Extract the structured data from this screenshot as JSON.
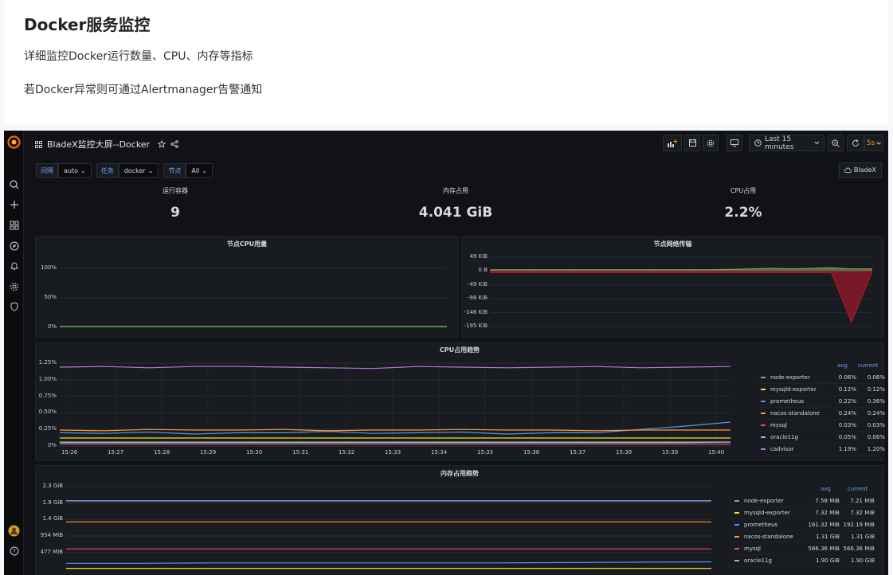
{
  "doc": {
    "title": "Docker服务监控",
    "line1": "详细监控Docker运行数量、CPU、内存等指标",
    "line2": "若Docker异常则可通过Alertmanager告警通知"
  },
  "topbar": {
    "dashboard_title": "BladeX监控大屏--Docker",
    "time_range": "Last 15 minutes",
    "refresh": "5s"
  },
  "variables": [
    {
      "label": "间隔",
      "value": "auto"
    },
    {
      "label": "任务",
      "value": "docker"
    },
    {
      "label": "节点",
      "value": "All"
    }
  ],
  "bladex_link": "BladeX",
  "stats": [
    {
      "title": "运行容器",
      "value": "9"
    },
    {
      "title": "内存占用",
      "value": "4.041 GiB"
    },
    {
      "title": "CPU占用",
      "value": "2.2%"
    }
  ],
  "colors": {
    "green": "#73bf69",
    "yellow": "#fade2a",
    "cyan": "#5794f2",
    "orange": "#ff9830",
    "red": "#f2495c",
    "blue": "#8ab8ff",
    "purple": "#b877d9",
    "lightblue": "#c0d8ff"
  },
  "chart_data": [
    {
      "type": "line",
      "title": "节点CPU用量",
      "y_ticks": [
        "100%",
        "50%",
        "0%"
      ],
      "ylim": [
        0,
        100
      ],
      "series": [
        {
          "values": [
            1.5,
            1.5,
            1.5,
            1.5,
            1.5,
            1.5,
            1.5,
            1.5,
            1.5,
            1.5,
            1.5,
            1.5,
            1.5,
            1.5,
            1.5,
            1.5
          ]
        }
      ]
    },
    {
      "type": "area",
      "title": "节点网络传输",
      "y_ticks": [
        "49 KiB",
        "0 B",
        "-49 KiB",
        "-98 KiB",
        "-146 KiB",
        "-195 KiB"
      ],
      "ylim": [
        -195,
        49
      ],
      "series": [
        {
          "values": [
            5,
            5,
            5,
            5,
            5,
            5,
            5,
            5,
            5,
            5,
            5,
            5,
            6,
            8,
            10,
            8,
            10,
            12,
            8,
            8
          ]
        },
        {
          "values": [
            -5,
            -6,
            -5,
            -6,
            -5,
            -6,
            -5,
            -6,
            -5,
            -6,
            -5,
            -6,
            -5,
            -6,
            -5,
            -6,
            -5,
            -6,
            -180,
            -8
          ]
        }
      ]
    },
    {
      "type": "line",
      "title": "CPU占用趋势",
      "y_ticks": [
        "1.25%",
        "1.00%",
        "0.75%",
        "0.50%",
        "0.25%",
        "0%"
      ],
      "x_ticks": [
        "15:26",
        "15:27",
        "15:28",
        "15:29",
        "15:30",
        "15:31",
        "15:32",
        "15:33",
        "15:34",
        "15:35",
        "15:36",
        "15:37",
        "15:38",
        "15:39",
        "15:40"
      ],
      "ylim": [
        0,
        1.25
      ],
      "legend_headers": {
        "avg": "avg",
        "current": "current"
      },
      "series": [
        {
          "name": "node-exporter",
          "avg": "0.06%",
          "current": "0.06%",
          "color": "#73bf69",
          "values": [
            0.06,
            0.06,
            0.06,
            0.06,
            0.06,
            0.06,
            0.06,
            0.06,
            0.06,
            0.06,
            0.06,
            0.06,
            0.06,
            0.06,
            0.06,
            0.06
          ]
        },
        {
          "name": "mysqld-exporter",
          "avg": "0.12%",
          "current": "0.12%",
          "color": "#fade2a",
          "values": [
            0.12,
            0.12,
            0.12,
            0.12,
            0.12,
            0.12,
            0.12,
            0.12,
            0.12,
            0.12,
            0.12,
            0.12,
            0.12,
            0.12,
            0.12,
            0.12
          ]
        },
        {
          "name": "prometheus",
          "avg": "0.22%",
          "current": "0.36%",
          "color": "#5794f2",
          "values": [
            0.2,
            0.19,
            0.21,
            0.18,
            0.2,
            0.2,
            0.22,
            0.19,
            0.2,
            0.21,
            0.18,
            0.2,
            0.2,
            0.25,
            0.3,
            0.36
          ]
        },
        {
          "name": "nacos-standalone",
          "avg": "0.24%",
          "current": "0.24%",
          "color": "#ff9830",
          "values": [
            0.24,
            0.23,
            0.25,
            0.24,
            0.24,
            0.25,
            0.23,
            0.24,
            0.24,
            0.25,
            0.24,
            0.24,
            0.23,
            0.24,
            0.24,
            0.24
          ]
        },
        {
          "name": "mysql",
          "avg": "0.03%",
          "current": "0.03%",
          "color": "#f2495c",
          "values": [
            0.03,
            0.03,
            0.03,
            0.03,
            0.03,
            0.03,
            0.03,
            0.03,
            0.03,
            0.03,
            0.03,
            0.03,
            0.03,
            0.03,
            0.03,
            0.03
          ]
        },
        {
          "name": "oracle11g",
          "avg": "0.05%",
          "current": "0.06%",
          "color": "#8ab8ff",
          "values": [
            0.05,
            0.05,
            0.05,
            0.05,
            0.05,
            0.05,
            0.05,
            0.05,
            0.05,
            0.05,
            0.05,
            0.05,
            0.05,
            0.05,
            0.05,
            0.06
          ]
        },
        {
          "name": "cadvisor",
          "avg": "1.19%",
          "current": "1.20%",
          "color": "#b877d9",
          "values": [
            1.19,
            1.2,
            1.18,
            1.2,
            1.2,
            1.19,
            1.18,
            1.17,
            1.2,
            1.19,
            1.18,
            1.19,
            1.2,
            1.18,
            1.19,
            1.2
          ]
        }
      ]
    },
    {
      "type": "line",
      "title": "内存占用趋势",
      "y_ticks": [
        "2.3 GiB",
        "1.9 GiB",
        "1.4 GiB",
        "954 MiB",
        "477 MiB"
      ],
      "ylim": [
        0,
        2.3
      ],
      "legend_headers": {
        "avg": "avg",
        "current": "current"
      },
      "series": [
        {
          "name": "node-exporter",
          "avg": "7.58 MiB",
          "current": "7.21 MiB",
          "color": "#73bf69",
          "values": [
            0.007,
            0.007,
            0.007,
            0.007,
            0.007,
            0.007,
            0.007,
            0.007,
            0.007,
            0.007
          ]
        },
        {
          "name": "mysqld-exporter",
          "avg": "7.32 MiB",
          "current": "7.32 MiB",
          "color": "#fade2a",
          "values": [
            0.007,
            0.007,
            0.007,
            0.007,
            0.007,
            0.007,
            0.007,
            0.007,
            0.007,
            0.007
          ]
        },
        {
          "name": "prometheus",
          "avg": "161.32 MiB",
          "current": "192.19 MiB",
          "color": "#5794f2",
          "values": [
            0.15,
            0.15,
            0.16,
            0.16,
            0.16,
            0.16,
            0.16,
            0.17,
            0.18,
            0.19
          ]
        },
        {
          "name": "nacos-standalone",
          "avg": "1.31 GiB",
          "current": "1.31 GiB",
          "color": "#ff9830",
          "values": [
            1.31,
            1.31,
            1.31,
            1.31,
            1.31,
            1.31,
            1.31,
            1.31,
            1.31,
            1.31
          ]
        },
        {
          "name": "mysql",
          "avg": "566.36 MiB",
          "current": "566.36 MiB",
          "color": "#f2495c",
          "values": [
            0.553,
            0.553,
            0.553,
            0.553,
            0.553,
            0.553,
            0.553,
            0.553,
            0.553,
            0.553
          ]
        },
        {
          "name": "oracle11g",
          "avg": "1.90 GiB",
          "current": "1.90 GiB",
          "color": "#8ab8ff",
          "values": [
            1.9,
            1.9,
            1.9,
            1.9,
            1.9,
            1.9,
            1.9,
            1.9,
            1.9,
            1.9
          ]
        }
      ]
    }
  ]
}
